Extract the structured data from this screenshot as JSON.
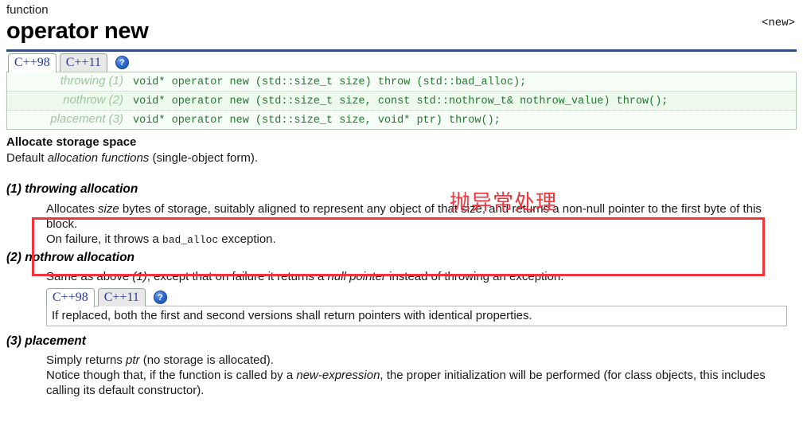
{
  "header": {
    "kind": "function",
    "title": "operator new",
    "right_link": "<new>"
  },
  "tabs": {
    "items": [
      {
        "label": "C++98",
        "active": true
      },
      {
        "label": "C++11",
        "active": false
      }
    ],
    "help_icon": "?"
  },
  "signatures": [
    {
      "label": "throwing (1)",
      "code": "void* operator new (std::size_t size) throw (std::bad_alloc);"
    },
    {
      "label": "nothrow (2)",
      "code": "void* operator new (std::size_t size, const std::nothrow_t& nothrow_value) throw();"
    },
    {
      "label": "placement (3)",
      "code": "void* operator new (std::size_t size, void* ptr) throw();"
    }
  ],
  "description": {
    "heading": "Allocate storage space",
    "subtitle_pre": "Default ",
    "subtitle_em": "allocation functions",
    "subtitle_post": " (single-object form)."
  },
  "sections": {
    "one": {
      "heading": "(1) throwing allocation",
      "line1_pre": "Allocates ",
      "line1_em": "size",
      "line1_post": " bytes of storage, suitably aligned to represent any object of that size, and returns a non-null pointer to the first byte of this block.",
      "line2_pre": "On failure, it throws a ",
      "line2_code": "bad_alloc",
      "line2_post": " exception."
    },
    "two": {
      "heading": "(2) nothrow allocation",
      "line1_pre": "Same as above ",
      "line1_em1": "(1)",
      "line1_mid": ", except that on failure it returns a ",
      "line1_em2": "null pointer",
      "line1_post": " instead of throwing an exception.",
      "tabs": [
        {
          "label": "C++98",
          "active": true
        },
        {
          "label": "C++11",
          "active": false
        }
      ],
      "help_icon": "?",
      "note": "If replaced, both the first and second versions shall return pointers with identical properties."
    },
    "three": {
      "heading": "(3) placement",
      "line1_pre": "Simply returns ",
      "line1_em": "ptr",
      "line1_post": " (no storage is allocated).",
      "line2_pre": "Notice though that, if the function is called by a ",
      "line2_em": "new-expression",
      "line2_post": ", the proper initialization will be performed (for class objects, this includes calling its default constructor)."
    }
  },
  "annotation": {
    "text": "抛异常处理",
    "color": "#f5333a"
  }
}
